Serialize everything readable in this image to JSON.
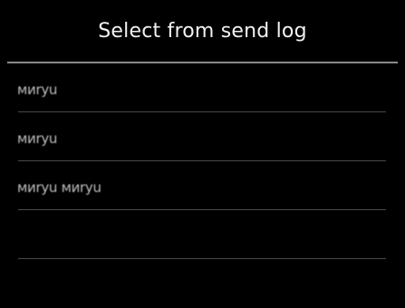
{
  "screen": {
    "title": "Select from send log"
  },
  "log": {
    "items": [
      {
        "label": "миryu"
      },
      {
        "label": "миryu"
      },
      {
        "label": "миryu миryu"
      },
      {
        "label": ""
      },
      {
        "label": ""
      }
    ]
  }
}
